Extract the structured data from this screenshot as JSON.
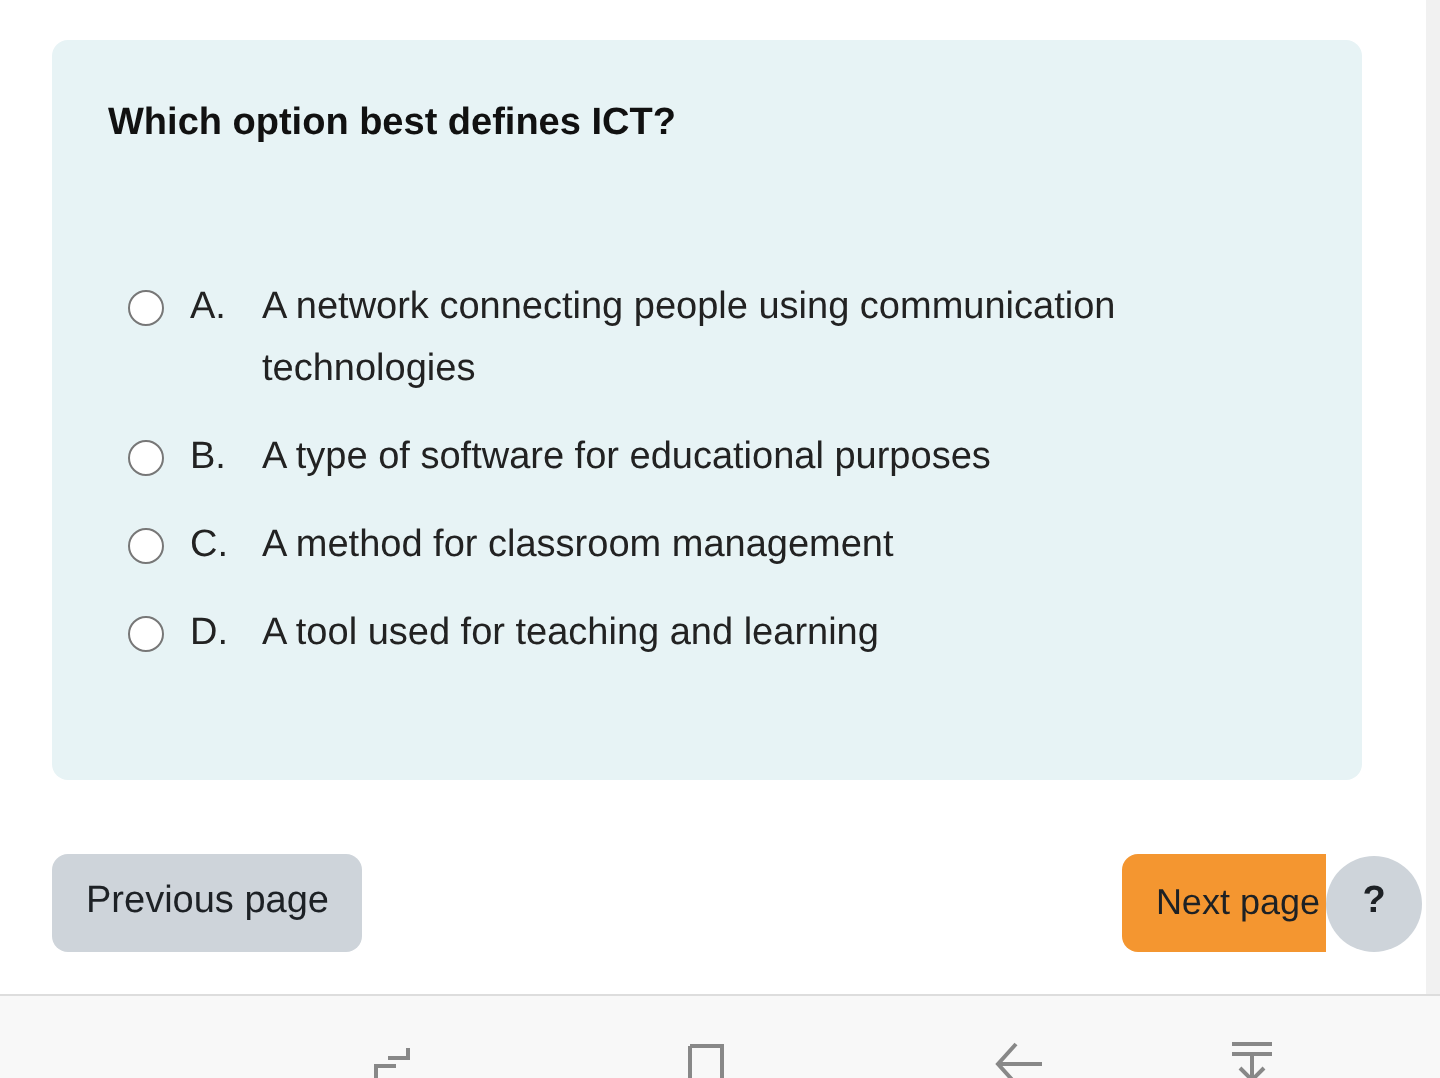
{
  "question": {
    "text": "Which option best defines ICT?",
    "options": [
      {
        "letter": "A.",
        "text": "A network connecting people using communication technologies",
        "selected": false
      },
      {
        "letter": "B.",
        "text": "A type of software for educational purposes",
        "selected": false
      },
      {
        "letter": "C.",
        "text": "A method for classroom management",
        "selected": false
      },
      {
        "letter": "D.",
        "text": "A tool used for teaching and learning",
        "selected": false
      }
    ]
  },
  "navigation": {
    "previous": "Previous page",
    "next": "Next page",
    "help": "?"
  }
}
